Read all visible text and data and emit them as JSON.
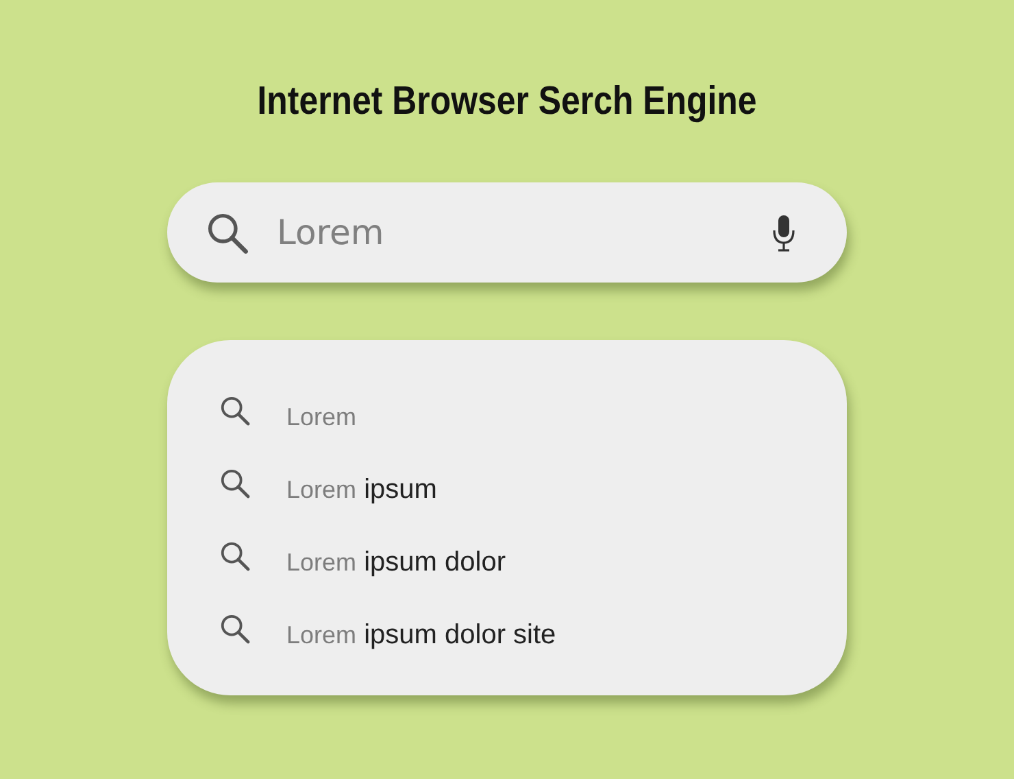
{
  "title": "Internet Browser Serch Engine",
  "search": {
    "placeholder": "Lorem"
  },
  "suggestions": [
    {
      "typed": "Lorem"
    },
    {
      "typed": "Lorem",
      "completion": "ipsum"
    },
    {
      "typed": "Lorem",
      "completion": "ipsum dolor"
    },
    {
      "typed": "Lorem",
      "completion": "ipsum dolor site"
    }
  ]
}
